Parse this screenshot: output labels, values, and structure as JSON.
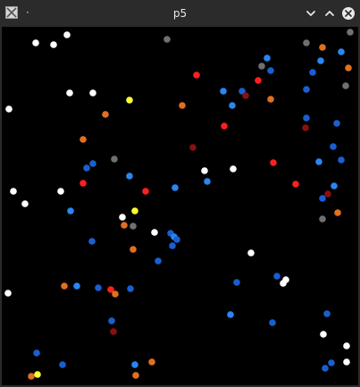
{
  "window": {
    "title": "p5",
    "app_icon": "app-icon",
    "menu_glyph": "·",
    "controls": [
      "minimize-icon",
      "maximize-icon",
      "close-icon"
    ]
  },
  "canvas": {
    "background": "#000000",
    "dot_colors": {
      "white": "#ffffff",
      "gray": "#707070",
      "blue": "#1a5fd0",
      "light_blue": "#2a86f0",
      "orange": "#e07020",
      "red": "#ff1f1f",
      "dark_red": "#8a1010",
      "yellow": "#ffff30"
    },
    "dot_count": 96
  }
}
